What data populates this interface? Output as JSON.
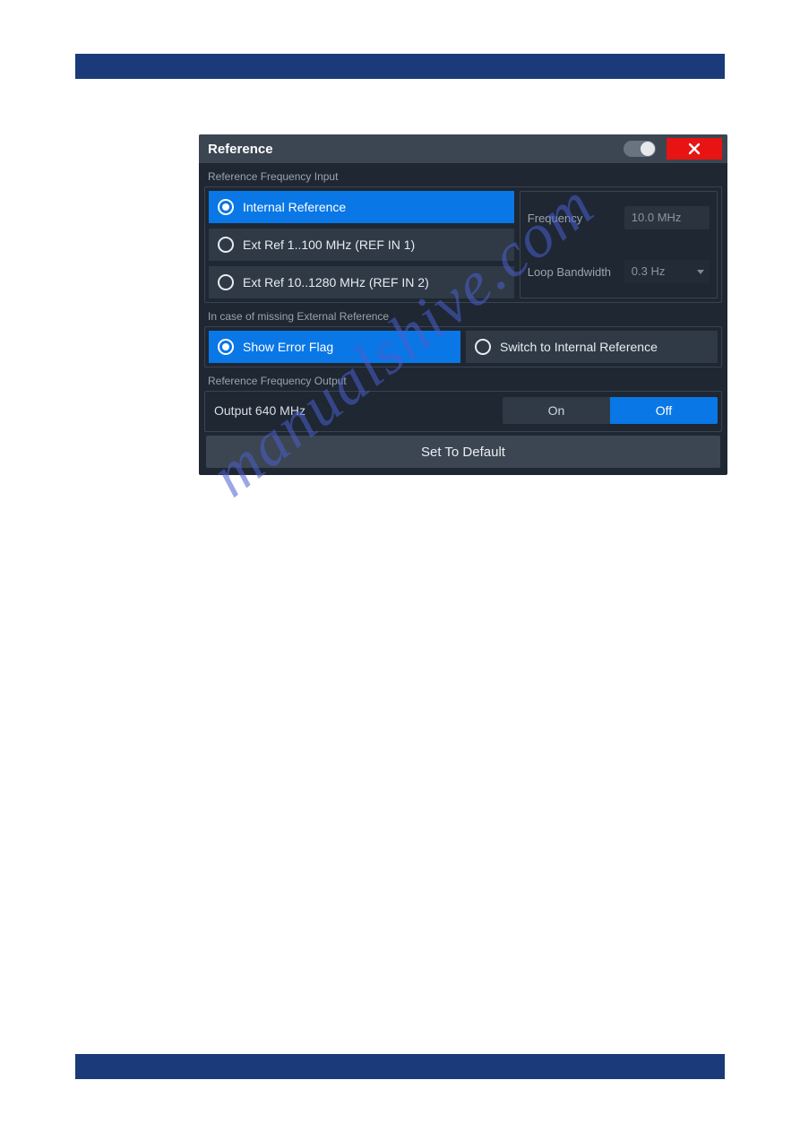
{
  "watermark": "manualshive.com",
  "panel": {
    "title": "Reference",
    "input_section_label": "Reference Frequency Input",
    "radios": [
      {
        "label": "Internal Reference",
        "selected": true
      },
      {
        "label": "Ext Ref  1..100 MHz (REF IN 1)",
        "selected": false
      },
      {
        "label": "Ext Ref  10..1280 MHz (REF IN 2)",
        "selected": false
      }
    ],
    "frequency_label": "Frequency",
    "frequency_value": "10.0 MHz",
    "loop_bw_label": "Loop Bandwidth",
    "loop_bw_value": "0.3 Hz",
    "missing_label": "In case of missing External Reference",
    "missing_options": [
      {
        "label": "Show Error Flag",
        "selected": true
      },
      {
        "label": "Switch to Internal Reference",
        "selected": false
      }
    ],
    "output_section_label": "Reference Frequency Output",
    "output_row_label": "Output 640 MHz",
    "output_options": [
      {
        "label": "On",
        "selected": false
      },
      {
        "label": "Off",
        "selected": true
      }
    ],
    "default_button": "Set To Default"
  }
}
